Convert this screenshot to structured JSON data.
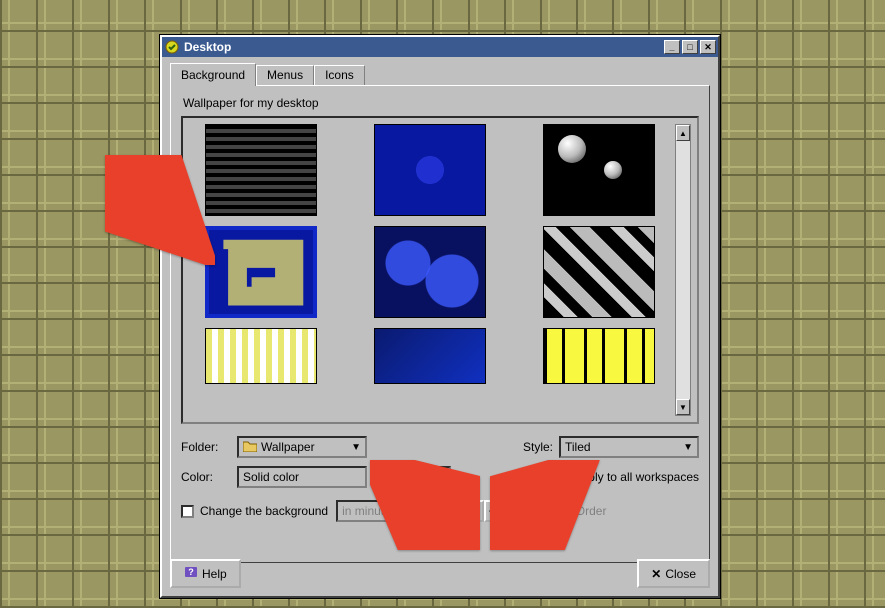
{
  "window": {
    "title": "Desktop"
  },
  "tabs": {
    "background": "Background",
    "menus": "Menus",
    "icons": "Icons"
  },
  "section": {
    "wallpaper_label": "Wallpaper for my desktop"
  },
  "form": {
    "folder_label": "Folder:",
    "folder_value": "Wallpaper",
    "style_label": "Style:",
    "style_value": "Tiled",
    "color_label": "Color:",
    "color_value": "Solid color",
    "apply_all_label": "Apply to all workspaces",
    "apply_all_checked": true,
    "change_bg_label": "Change the background",
    "change_bg_checked": false,
    "change_unit": "in minutes:",
    "random_label": "Random Order",
    "random_checked": false
  },
  "buttons": {
    "help": "Help",
    "close": "Close"
  },
  "thumbnails": [
    {
      "id": "pattern-stripes-quad"
    },
    {
      "id": "pattern-blue-gem"
    },
    {
      "id": "pattern-bubbles"
    },
    {
      "id": "pattern-greek-maze",
      "selected": true
    },
    {
      "id": "pattern-blue-circles"
    },
    {
      "id": "pattern-houndstooth"
    },
    {
      "id": "pattern-yellow-stripes"
    },
    {
      "id": "pattern-blue-tech"
    },
    {
      "id": "pattern-bamboo"
    }
  ]
}
